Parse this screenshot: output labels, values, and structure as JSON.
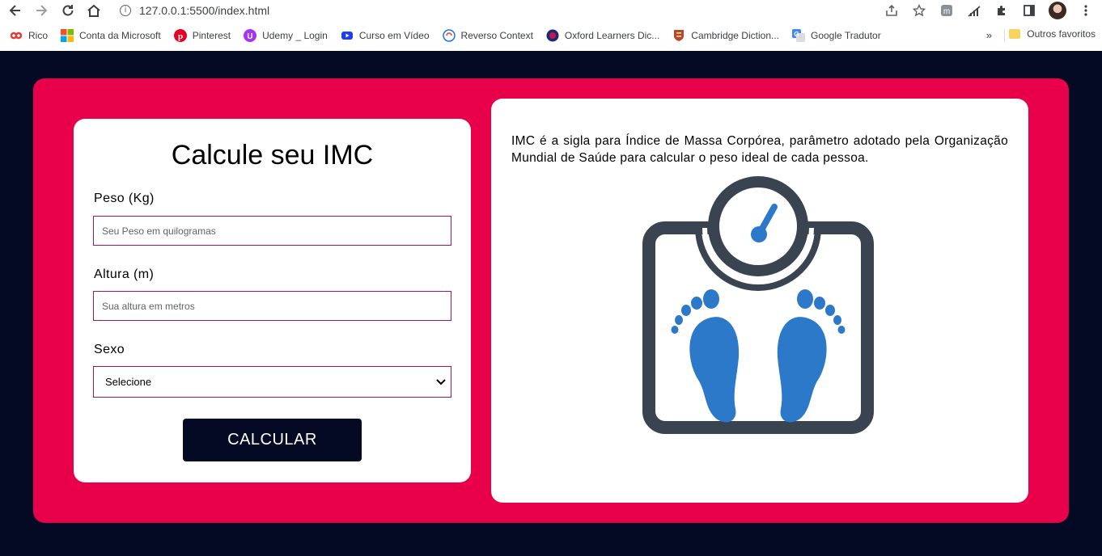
{
  "browser": {
    "url": "127.0.0.1:5500/index.html",
    "bookmarks": [
      {
        "label": "Rico",
        "color": "#e53935"
      },
      {
        "label": "Conta da Microsoft",
        "color": "#f25022"
      },
      {
        "label": "Pinterest",
        "color": "#e60023"
      },
      {
        "label": "Udemy _ Login",
        "color": "#a435f0"
      },
      {
        "label": "Curso em Vídeo",
        "color": "#1e3cf0"
      },
      {
        "label": "Reverso Context",
        "color": "#1a73e8"
      },
      {
        "label": "Oxford Learners Dic...",
        "color": "#1d2a6b"
      },
      {
        "label": "Cambridge Diction...",
        "color": "#b5482a"
      },
      {
        "label": "Google Tradutor",
        "color": "#4285f4"
      }
    ],
    "more": "»",
    "other_bookmarks": "Outros favoritos"
  },
  "form": {
    "title": "Calcule seu IMC",
    "weight_label": "Peso (Kg)",
    "weight_placeholder": "Seu Peso em quilogramas",
    "height_label": "Altura (m)",
    "height_placeholder": "Sua altura em metros",
    "sex_label": "Sexo",
    "sex_selected": "Selecione",
    "button": "CALCULAR"
  },
  "info": {
    "text": "IMC é a sigla para Índice de Massa Corpórea, parâmetro adotado pela Organização Mundial de Saúde para calcular o peso ideal de cada pessoa."
  },
  "colors": {
    "background": "#050a24",
    "card": "#e8004b",
    "input_border": "#a0185a",
    "scale_dark": "#3a4350",
    "scale_blue": "#2b79c8"
  }
}
